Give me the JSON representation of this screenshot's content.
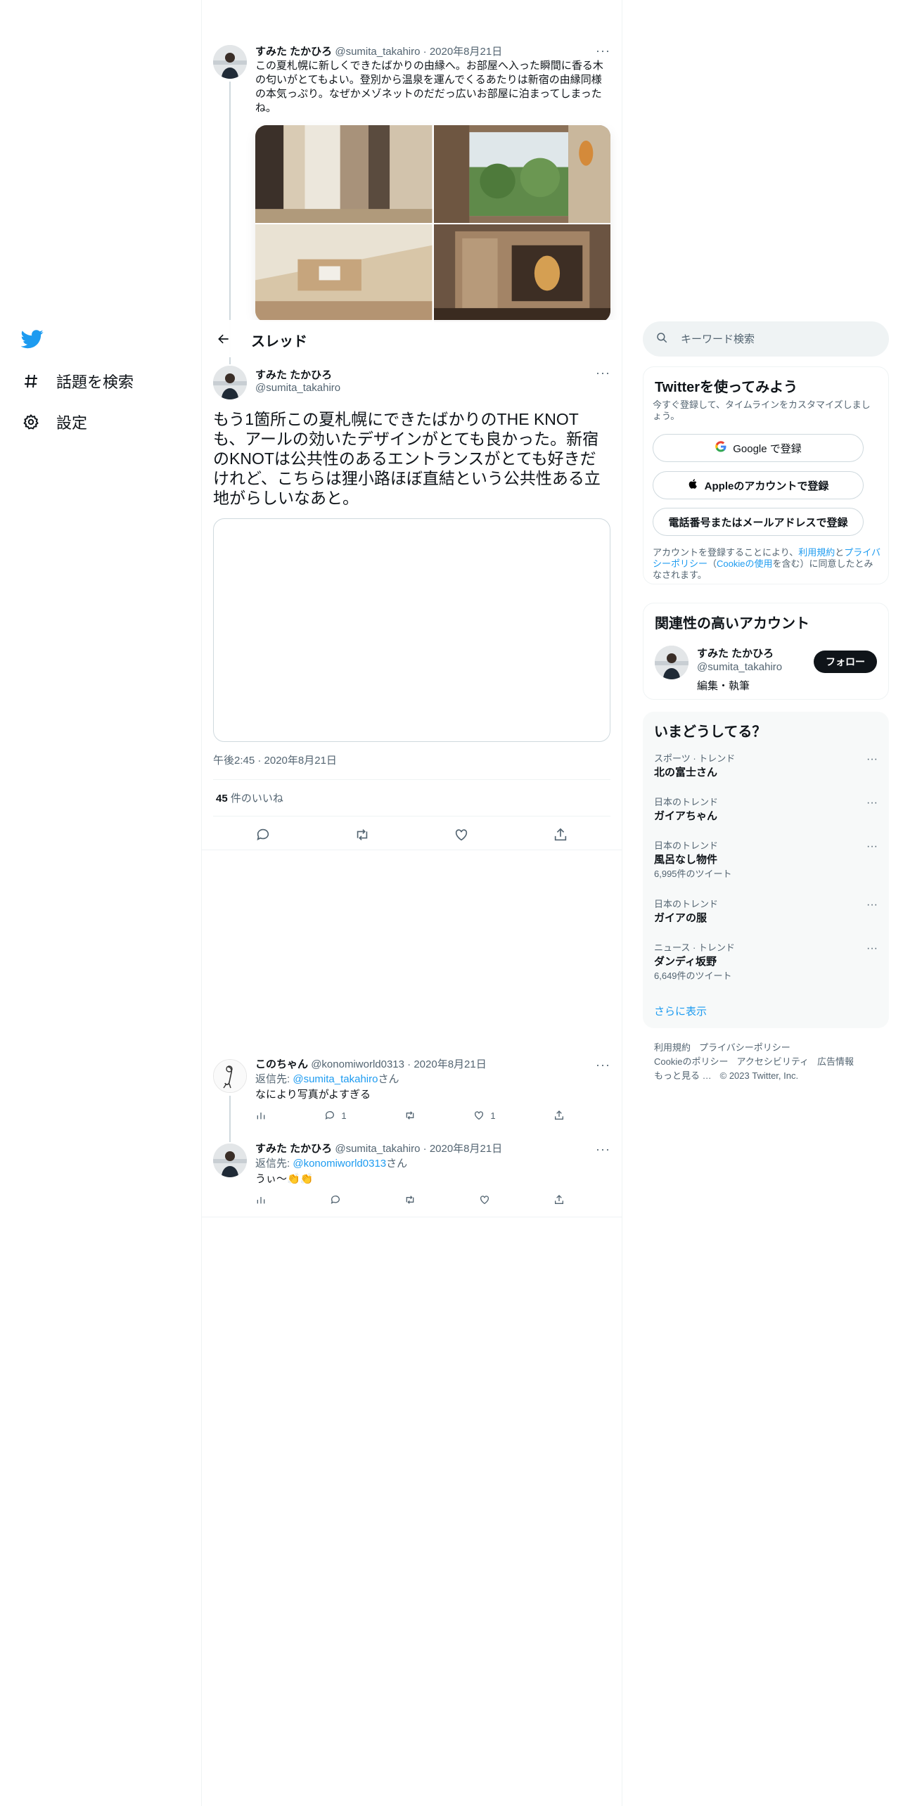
{
  "nav": {
    "items": [
      {
        "label": "話題を検索",
        "icon": "hashtag-icon"
      },
      {
        "label": "設定",
        "icon": "gear-icon"
      }
    ]
  },
  "prev_tweet": {
    "name": "すみた たかひろ",
    "handle": "@sumita_takahiro",
    "date": "2020年8月21日",
    "text": "この夏札幌に新しくできたばかりの由縁へ。お部屋へ入った瞬間に香る木の匂いがとてもよい。登別から温泉を運んでくるあたりは新宿の由縁同様の本気っぷり。なぜかメゾネットのだだっ広いお部屋に泊まってしまったね。",
    "more": "···"
  },
  "thread_header": {
    "title": "スレッド"
  },
  "main_tweet": {
    "name": "すみた たかひろ",
    "handle": "@sumita_takahiro",
    "text": "もう1箇所この夏札幌にできたばかりのTHE KNOTも、アールの効いたデザインがとても良かった。新宿のKNOTは公共性のあるエントランスがとても好きだけれど、こちらは狸小路ほぼ直結という公共性ある立地がらしいなあと。",
    "time": "午後2:45 · 2020年8月21日",
    "likes_count": "45",
    "likes_label": "件のいいね",
    "more": "···"
  },
  "replies": [
    {
      "name": "このちゃん",
      "handle": "@konomiworld0313",
      "date": "2020年8月21日",
      "reply_prefix": "返信先: ",
      "reply_to": "@sumita_takahiro",
      "reply_suffix": "さん",
      "text": "なにより写真がよすぎる",
      "reply_count": "1",
      "like_count": "1",
      "more": "···"
    },
    {
      "name": "すみた たかひろ",
      "handle": "@sumita_takahiro",
      "date": "2020年8月21日",
      "reply_prefix": "返信先: ",
      "reply_to": "@konomiworld0313",
      "reply_suffix": "さん",
      "text": "うぃ〜👏👏",
      "reply_count": "",
      "like_count": "",
      "more": "···"
    }
  ],
  "search": {
    "placeholder": "キーワード検索"
  },
  "signup": {
    "title": "Twitterを使ってみよう",
    "subtitle": "今すぐ登録して、タイムラインをカスタマイズしましょう。",
    "google": "Google で登録",
    "apple": "Appleのアカウントで登録",
    "phone": "電話番号またはメールアドレスで登録",
    "terms_pre": "アカウントを登録することにより、",
    "terms_link": "利用規約",
    "terms_and": "と",
    "privacy_link": "プライバシーポリシー",
    "terms_paren_open": "（",
    "cookie_link": "Cookieの使用",
    "terms_post": "を含む）に同意したとみなされます。"
  },
  "relevant": {
    "title": "関連性の高いアカウント",
    "name": "すみた たかひろ",
    "handle": "@sumita_takahiro",
    "bio": "編集・執筆",
    "follow": "フォロー"
  },
  "trends": {
    "title": "いまどうしてる？",
    "items": [
      {
        "category": "スポーツ · トレンド",
        "name": "北の富士さん",
        "count": ""
      },
      {
        "category": "日本のトレンド",
        "name": "ガイアちゃん",
        "count": ""
      },
      {
        "category": "日本のトレンド",
        "name": "風呂なし物件",
        "count": "6,995件のツイート"
      },
      {
        "category": "日本のトレンド",
        "name": "ガイアの服",
        "count": ""
      },
      {
        "category": "ニュース · トレンド",
        "name": "ダンディ坂野",
        "count": "6,649件のツイート"
      }
    ],
    "show_more": "さらに表示"
  },
  "footer": {
    "links": [
      "利用規約",
      "プライバシーポリシー",
      "Cookieのポリシー",
      "アクセシビリティ",
      "広告情報",
      "もっと見る …"
    ],
    "copyright": "© 2023 Twitter, Inc."
  },
  "colors": {
    "accent": "#1d9bf0",
    "text": "#0f1419",
    "muted": "#536471",
    "border": "#eff3f4"
  }
}
